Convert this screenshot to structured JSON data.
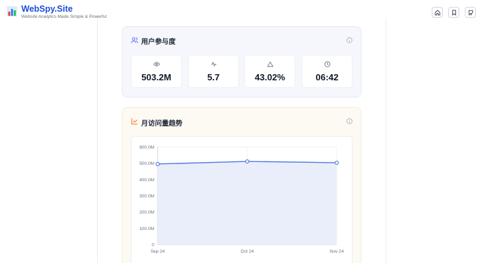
{
  "header": {
    "site_name": "WebSpy.Site",
    "tagline": "Website Analytics Made Simple & Powerful",
    "buttons": [
      {
        "icon": "home-icon"
      },
      {
        "icon": "bookmark-icon"
      },
      {
        "icon": "github-icon"
      }
    ]
  },
  "engagement": {
    "title": "用户参与度",
    "metrics": [
      {
        "icon": "eye-icon",
        "value": "503.2M"
      },
      {
        "icon": "activity-icon",
        "value": "5.7"
      },
      {
        "icon": "triangle-icon",
        "value": "43.02%"
      },
      {
        "icon": "clock-icon",
        "value": "06:42"
      }
    ]
  },
  "trend": {
    "title": "月访问量趋势"
  },
  "colors": {
    "brand": "#1d4ed8",
    "line": "#4f7ce0",
    "area": "#eaeefb"
  },
  "chart_data": {
    "type": "area",
    "categories": [
      "Sep 24",
      "Oct 24",
      "Nov 24"
    ],
    "values": [
      495000000,
      511000000,
      503000000
    ],
    "ylim": [
      0,
      600000000
    ],
    "yticks": [
      {
        "value": 0,
        "label": "0"
      },
      {
        "value": 100000000,
        "label": "100.0M"
      },
      {
        "value": 200000000,
        "label": "200.0M"
      },
      {
        "value": 300000000,
        "label": "300.0M"
      },
      {
        "value": 400000000,
        "label": "400.0M"
      },
      {
        "value": 500000000,
        "label": "500.0M"
      },
      {
        "value": 600000000,
        "label": "600.0M"
      }
    ],
    "grid": true
  }
}
